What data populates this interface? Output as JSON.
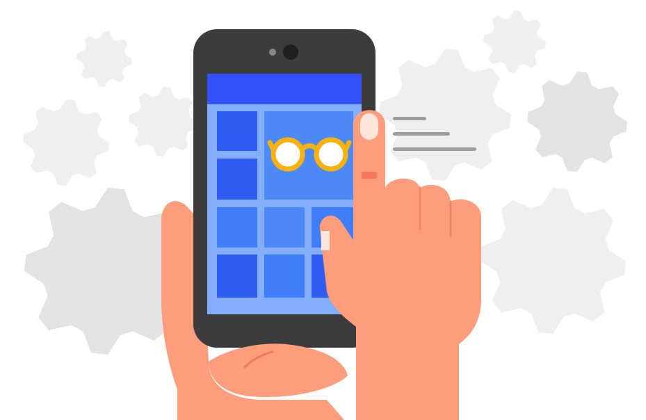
{
  "illustration": {
    "subject": "accessibility-settings",
    "colors": {
      "background": "#ffffff",
      "gear_light": "#efefef",
      "gear_mid": "#e3e3e3",
      "phone_body": "#3c3c3c",
      "phone_camera": "#1e1e1e",
      "phone_sensor": "#8a8a8a",
      "screen_base": "#84aefc",
      "app_bar": "#3653fb",
      "tile_dark": "#2f5cf3",
      "tile_mid": "#3f7ef8",
      "tile_light": "#4e8af7",
      "glasses_frame": "#f7b20f",
      "glasses_lens": "#ffffff",
      "skin": "#fd9d7c",
      "skin_shadow": "#f2886a",
      "nail": "#ffe6da",
      "detail_lines": "#9e9e9e",
      "cuff": "#f27a58"
    },
    "icons": [
      "gear-icon",
      "glasses-icon",
      "phone-icon"
    ]
  }
}
